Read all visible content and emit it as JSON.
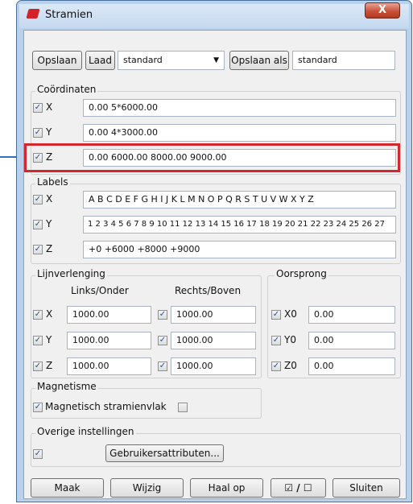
{
  "window": {
    "title": "Stramien",
    "close_label": "X"
  },
  "toolbar": {
    "save_label": "Opslaan",
    "load_label": "Laad",
    "preset_value": "standard",
    "save_as_label": "Opslaan als",
    "save_as_value": "standard"
  },
  "coords": {
    "title": "Coördinaten",
    "rows": [
      {
        "label": "X",
        "checked": true,
        "value": "0.00 5*6000.00"
      },
      {
        "label": "Y",
        "checked": true,
        "value": "0.00 4*3000.00"
      },
      {
        "label": "Z",
        "checked": true,
        "value": "0.00 6000.00 8000.00 9000.00"
      }
    ]
  },
  "labels": {
    "title": "Labels",
    "rows": [
      {
        "label": "X",
        "checked": true,
        "value": "A B C D E F G H I J K L M N O P Q R S T U V W X Y Z"
      },
      {
        "label": "Y",
        "checked": true,
        "value": "1 2 3 4 5 6 7 8 9 10 11 12 13 14 15 16 17 18 19 20 21 22 23 24 25 26 27"
      },
      {
        "label": "Z",
        "checked": true,
        "value": "+0 +6000 +8000 +9000"
      }
    ]
  },
  "extension": {
    "title": "Lijnverlenging",
    "col_left": "Links/Onder",
    "col_right": "Rechts/Boven",
    "rows": [
      {
        "label": "X",
        "left": "1000.00",
        "right": "1000.00"
      },
      {
        "label": "Y",
        "left": "1000.00",
        "right": "1000.00"
      },
      {
        "label": "Z",
        "left": "1000.00",
        "right": "1000.00"
      }
    ]
  },
  "origin": {
    "title": "Oorsprong",
    "rows": [
      {
        "label": "X0",
        "value": "0.00"
      },
      {
        "label": "Y0",
        "value": "0.00"
      },
      {
        "label": "Z0",
        "value": "0.00"
      }
    ]
  },
  "magnetism": {
    "title": "Magnetisme",
    "option_label": "Magnetisch stramienvlak"
  },
  "other": {
    "title": "Overige instellingen",
    "user_attr_label": "Gebruikersattributen..."
  },
  "footer": {
    "make_label": "Maak",
    "modify_label": "Wijzig",
    "fetch_label": "Haal op",
    "toggle_label": "☑ / ☐",
    "close_label": "Sluiten"
  },
  "colors": {
    "highlight": "#d6262e",
    "arrow": "#2d6fc2",
    "titlebar": "#c4d8ef"
  }
}
